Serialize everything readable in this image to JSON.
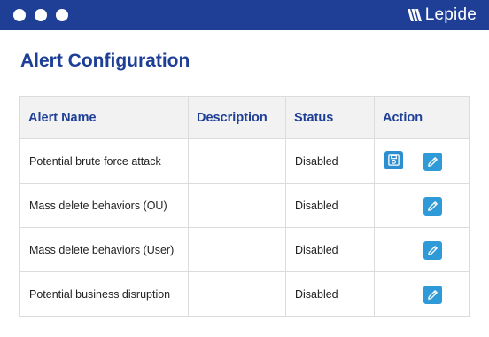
{
  "window": {
    "brand": "Lepide",
    "controls": [
      "window-dot",
      "window-dot",
      "window-dot"
    ]
  },
  "page": {
    "title": "Alert Configuration"
  },
  "table": {
    "headers": {
      "alert_name": "Alert Name",
      "description": "Description",
      "status": "Status",
      "action": "Action"
    },
    "rows": [
      {
        "alert_name": "Potential brute force attack",
        "description": "",
        "status": "Disabled",
        "actions": [
          "save-icon",
          "edit-icon"
        ]
      },
      {
        "alert_name": "Mass delete behaviors (OU)",
        "description": "",
        "status": "Disabled",
        "actions": [
          "edit-icon"
        ]
      },
      {
        "alert_name": "Mass delete behaviors (User)",
        "description": "",
        "status": "Disabled",
        "actions": [
          "edit-icon"
        ]
      },
      {
        "alert_name": "Potential business disruption",
        "description": "",
        "status": "Disabled",
        "actions": [
          "edit-icon"
        ]
      }
    ]
  },
  "colors": {
    "brand_blue": "#1f3f97",
    "status_disabled": "#c00000",
    "action_button": "#2e9ad8",
    "header_bg": "#f2f2f2"
  }
}
